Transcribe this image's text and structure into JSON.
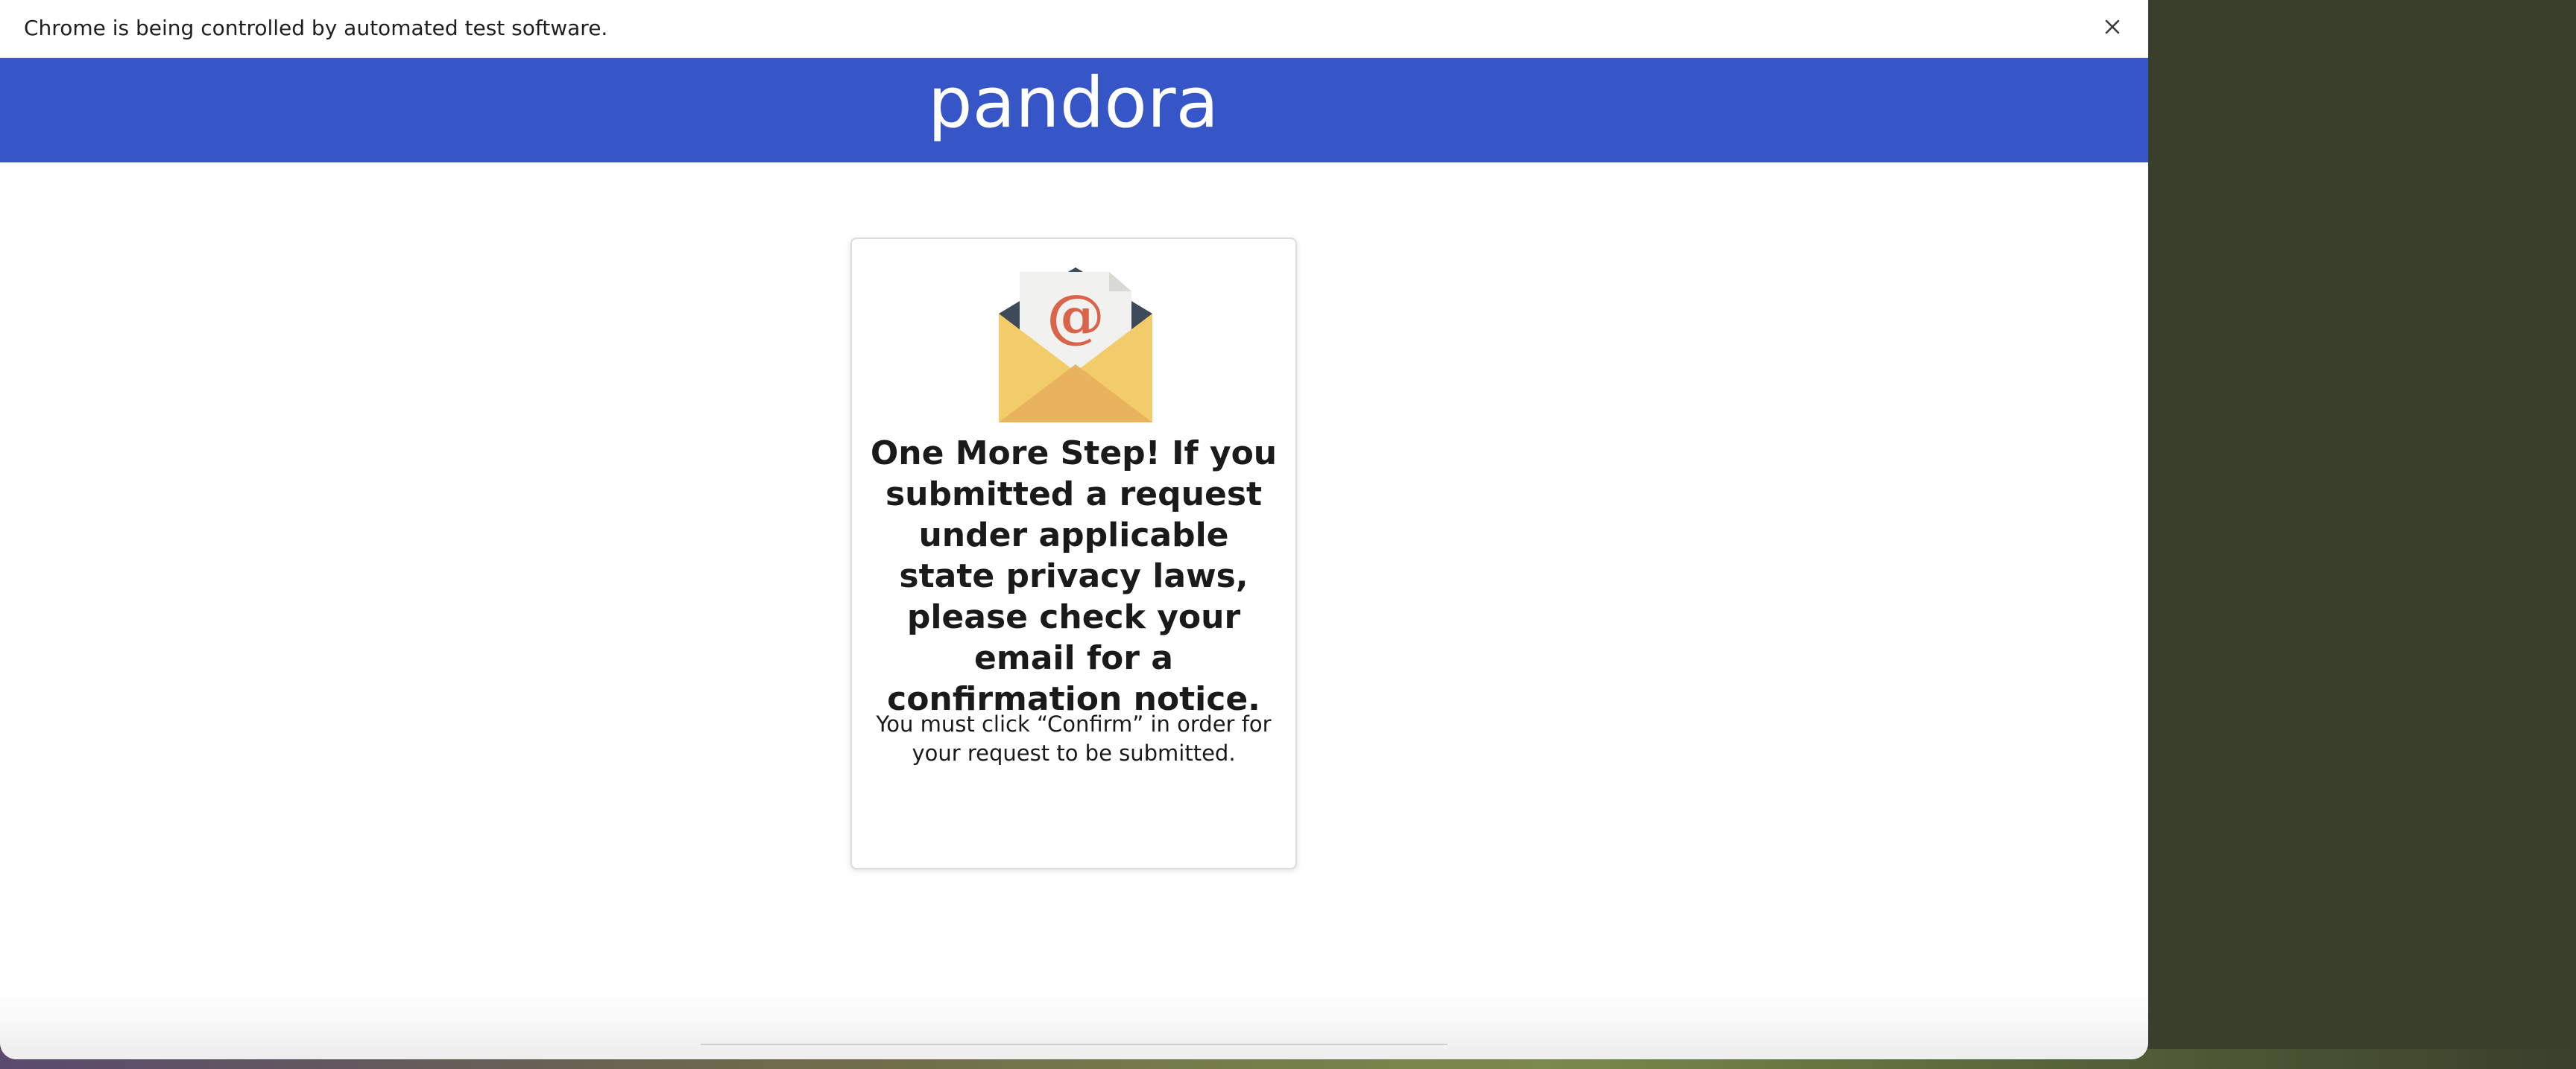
{
  "infobar": {
    "message": "Chrome is being controlled by automated test software.",
    "close_icon": "close-icon"
  },
  "header": {
    "logo_text": "pandora",
    "brand_color": "#3656c8"
  },
  "card": {
    "icon": "email-envelope-icon",
    "heading": "One More Step! If you submitted a request under applicable state privacy laws, please check your email for a confirmation notice.",
    "body": "You must click “Confirm” in order for your request to be submitted."
  }
}
